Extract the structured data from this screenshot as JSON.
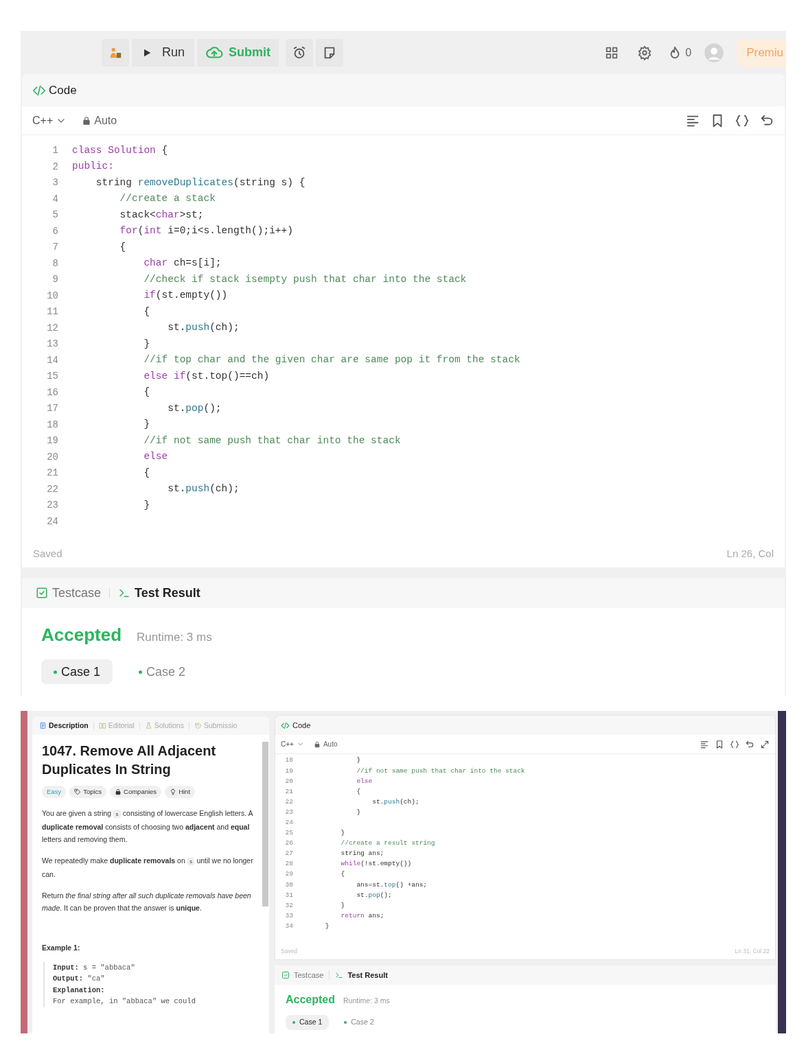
{
  "top_editor": {
    "toolbar": {
      "left": [
        {
          "kind": "icon"
        },
        {
          "kind": "run",
          "label": "Run"
        },
        {
          "kind": "submit",
          "label": "Submit"
        },
        {
          "kind": "icon"
        },
        {
          "kind": "icon"
        }
      ],
      "right": [
        {
          "kind": "icon"
        },
        {
          "kind": "icon"
        },
        {
          "kind": "streak",
          "label": "0"
        },
        {
          "kind": "avatar"
        },
        {
          "kind": "premium",
          "label": "Premiu"
        }
      ]
    },
    "panel_title": "Code",
    "language": "C++",
    "mode": "Auto",
    "lines": [
      {
        "number": "1",
        "segments": [
          {
            "kind": "keyword",
            "t": "class Solution"
          },
          {
            "kind": "plain",
            "t": " {"
          }
        ]
      },
      {
        "number": "2",
        "segments": [
          {
            "kind": "keyword",
            "t": "public:"
          }
        ]
      },
      {
        "number": "3",
        "segments": [
          {
            "kind": "plain",
            "t": "    string "
          },
          {
            "kind": "method",
            "t": "removeDuplicates"
          },
          {
            "kind": "plain",
            "t": "(string s) {"
          }
        ]
      },
      {
        "number": "4",
        "segments": [
          {
            "kind": "comment",
            "t": "        //create a stack"
          }
        ]
      },
      {
        "number": "5",
        "segments": [
          {
            "kind": "plain",
            "t": "        stack<"
          },
          {
            "kind": "keyword",
            "t": "char"
          },
          {
            "kind": "plain",
            "t": ">st;"
          }
        ]
      },
      {
        "number": "6",
        "segments": [
          {
            "kind": "keyword",
            "t": "        for"
          },
          {
            "kind": "plain",
            "t": "("
          },
          {
            "kind": "keyword",
            "t": "int"
          },
          {
            "kind": "plain",
            "t": " i=0;i<s.length();i++)"
          }
        ]
      },
      {
        "number": "7",
        "segments": [
          {
            "kind": "plain",
            "t": "        {"
          }
        ]
      },
      {
        "number": "8",
        "segments": [
          {
            "kind": "keyword",
            "t": "            char"
          },
          {
            "kind": "plain",
            "t": " ch=s[i];"
          }
        ]
      },
      {
        "number": "9",
        "segments": [
          {
            "kind": "comment",
            "t": "            //check if stack isempty push that char into the stack"
          }
        ]
      },
      {
        "number": "10",
        "segments": [
          {
            "kind": "keyword",
            "t": "            if"
          },
          {
            "kind": "plain",
            "t": "(st.empty())"
          }
        ]
      },
      {
        "number": "11",
        "segments": [
          {
            "kind": "plain",
            "t": "            {"
          }
        ]
      },
      {
        "number": "12",
        "segments": [
          {
            "kind": "plain",
            "t": "                st."
          },
          {
            "kind": "method",
            "t": "push"
          },
          {
            "kind": "plain",
            "t": "(ch);"
          }
        ]
      },
      {
        "number": "13",
        "segments": [
          {
            "kind": "plain",
            "t": "            }"
          }
        ]
      },
      {
        "number": "14",
        "segments": [
          {
            "kind": "comment",
            "t": "            //if top char and the given char are same pop it from the stack"
          }
        ]
      },
      {
        "number": "15",
        "segments": [
          {
            "kind": "keyword",
            "t": "            else if"
          },
          {
            "kind": "plain",
            "t": "(st.top()==ch)"
          }
        ]
      },
      {
        "number": "16",
        "segments": [
          {
            "kind": "plain",
            "t": "            {"
          }
        ]
      },
      {
        "number": "17",
        "segments": [
          {
            "kind": "plain",
            "t": "                st."
          },
          {
            "kind": "method",
            "t": "pop"
          },
          {
            "kind": "plain",
            "t": "();"
          }
        ]
      },
      {
        "number": "18",
        "segments": [
          {
            "kind": "plain",
            "t": "            }"
          }
        ]
      },
      {
        "number": "19",
        "segments": [
          {
            "kind": "comment",
            "t": "            //if not same push that char into the stack"
          }
        ]
      },
      {
        "number": "20",
        "segments": [
          {
            "kind": "keyword",
            "t": "            else"
          }
        ]
      },
      {
        "number": "21",
        "segments": [
          {
            "kind": "plain",
            "t": "            {"
          }
        ]
      },
      {
        "number": "22",
        "segments": [
          {
            "kind": "plain",
            "t": "                st."
          },
          {
            "kind": "method",
            "t": "push"
          },
          {
            "kind": "plain",
            "t": "(ch);"
          }
        ]
      },
      {
        "number": "23",
        "segments": [
          {
            "kind": "plain",
            "t": "            }"
          }
        ]
      },
      {
        "number": "24"
      }
    ],
    "saved": "Saved",
    "cursor": "Ln 26, Col",
    "result_tabs": [
      {
        "label": "Testcase",
        "selected": false
      },
      {
        "label": "Test Result",
        "selected": true
      }
    ],
    "verdict": "Accepted",
    "runtime": "Runtime: 3 ms",
    "cases": [
      {
        "label": "Case 1",
        "selected": true
      },
      {
        "label": "Case 2",
        "selected": false
      }
    ]
  },
  "bottom_screen": {
    "description_tabs": [
      {
        "label": "Description",
        "selected": true
      },
      {
        "label": "Editorial",
        "selected": false
      },
      {
        "label": "Solutions",
        "selected": false
      },
      {
        "label": "Submissio",
        "selected": false
      }
    ],
    "title": "1047. Remove All Adjacent Duplicates In String",
    "tags": [
      {
        "kind": "difficulty",
        "label": "Easy"
      },
      {
        "kind": "topics",
        "label": "Topics"
      },
      {
        "kind": "companies",
        "label": "Companies"
      },
      {
        "kind": "hint",
        "label": "Hint"
      }
    ],
    "paragraphs": [
      [
        {
          "t": "You are given a string "
        },
        {
          "code": "s"
        },
        {
          "t": " consisting of lowercase English letters. A **duplicate removal** consists of choosing two **adjacent** and **equal** letters and removing them."
        }
      ],
      [
        {
          "t": "We repeatedly make **duplicate removals** on "
        },
        {
          "code": "s"
        },
        {
          "t": " until we no longer can."
        }
      ],
      [
        {
          "t": "Return *the final string after all such duplicate removals have been made*. It can be proven that the answer is **unique**."
        }
      ]
    ],
    "example_title": "Example 1:",
    "example": [
      {
        "label": "Input:",
        "value": " s = \"abbaca\""
      },
      {
        "label": "Output:",
        "value": " \"ca\""
      },
      {
        "label": "Explanation:"
      },
      {
        "value": "For example, in \"abbaca\" we could"
      }
    ],
    "panel_title": "Code",
    "language": "C++",
    "mode": "Auto",
    "lines": [
      {
        "number": "18",
        "segments": [
          {
            "kind": "plain",
            "t": "            }"
          }
        ]
      },
      {
        "number": "19",
        "segments": [
          {
            "kind": "comment",
            "t": "            //if not same push that char into the stack"
          }
        ]
      },
      {
        "number": "20",
        "segments": [
          {
            "kind": "keyword",
            "t": "            else"
          }
        ]
      },
      {
        "number": "21",
        "segments": [
          {
            "kind": "plain",
            "t": "            {"
          }
        ]
      },
      {
        "number": "22",
        "segments": [
          {
            "kind": "plain",
            "t": "                st."
          },
          {
            "kind": "method",
            "t": "push"
          },
          {
            "kind": "plain",
            "t": "(ch);"
          }
        ]
      },
      {
        "number": "23",
        "segments": [
          {
            "kind": "plain",
            "t": "            }"
          }
        ]
      },
      {
        "number": "24"
      },
      {
        "number": "25",
        "segments": [
          {
            "kind": "plain",
            "t": "        }"
          }
        ]
      },
      {
        "number": "26",
        "segments": [
          {
            "kind": "comment",
            "t": "        //create a result string"
          }
        ]
      },
      {
        "number": "27",
        "segments": [
          {
            "kind": "plain",
            "t": "        string ans;"
          }
        ]
      },
      {
        "number": "28",
        "segments": [
          {
            "kind": "keyword",
            "t": "        while"
          },
          {
            "kind": "plain",
            "t": "(!st.empty())"
          }
        ]
      },
      {
        "number": "29",
        "segments": [
          {
            "kind": "plain",
            "t": "        {"
          }
        ]
      },
      {
        "number": "30",
        "segments": [
          {
            "kind": "plain",
            "t": "            ans=st."
          },
          {
            "kind": "method",
            "t": "top"
          },
          {
            "kind": "plain",
            "t": "() +ans;"
          }
        ]
      },
      {
        "number": "31",
        "segments": [
          {
            "kind": "plain",
            "t": "            st."
          },
          {
            "kind": "method",
            "t": "pop"
          },
          {
            "kind": "plain",
            "t": "();"
          }
        ]
      },
      {
        "number": "32",
        "segments": [
          {
            "kind": "plain",
            "t": "        }"
          }
        ]
      },
      {
        "number": "33",
        "segments": [
          {
            "kind": "keyword",
            "t": "        return"
          },
          {
            "kind": "plain",
            "t": " ans;"
          }
        ]
      },
      {
        "number": "34",
        "segments": [
          {
            "kind": "plain",
            "t": "    }"
          }
        ]
      }
    ],
    "saved": "Saved",
    "cursor": "Ln 31, Col 22",
    "result_tabs": [
      {
        "label": "Testcase",
        "selected": false
      },
      {
        "label": "Test Result",
        "selected": true
      }
    ],
    "verdict": "Accepted",
    "runtime": "Runtime: 3 ms",
    "cases": [
      {
        "label": "Case 1",
        "selected": true
      },
      {
        "label": "Case 2",
        "selected": false
      }
    ]
  }
}
